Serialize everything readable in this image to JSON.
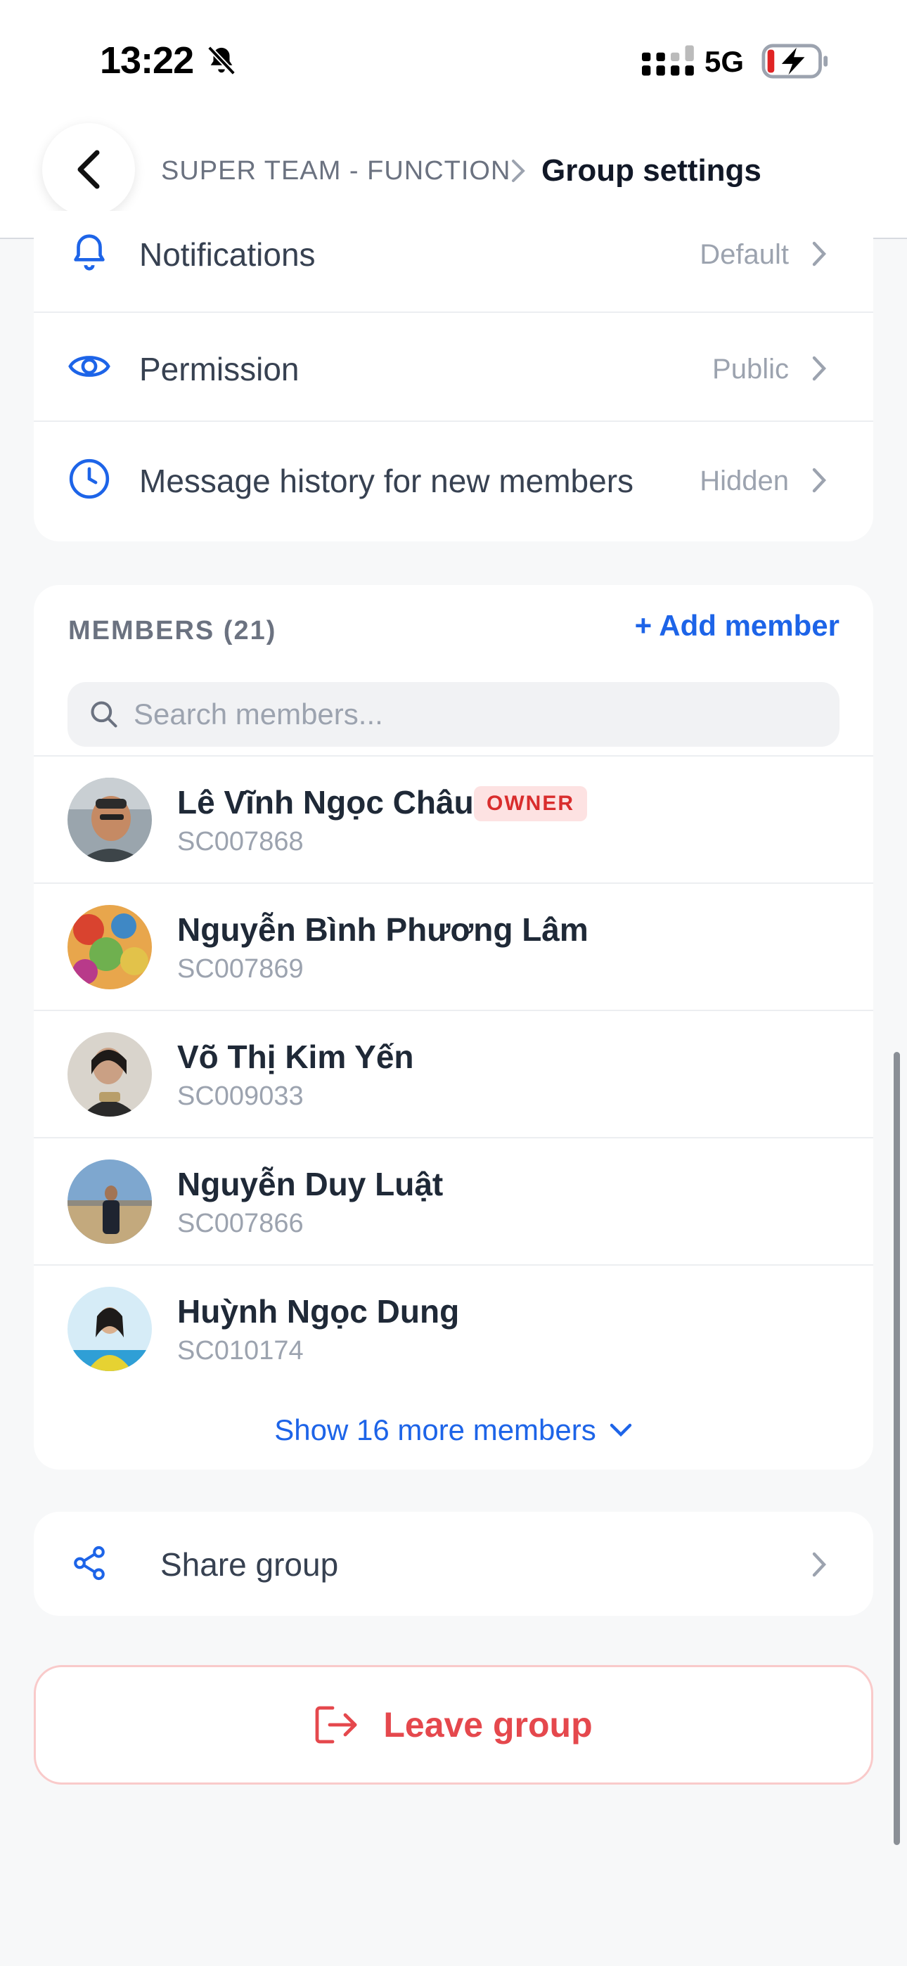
{
  "status_bar": {
    "time": "13:22",
    "network": "5G",
    "icons": [
      "bell-slash-icon",
      "signal-icon",
      "battery-charging-icon"
    ]
  },
  "header": {
    "parent_crumb": "SUPER TEAM - FUNCTION",
    "current_crumb": "Group settings",
    "icons": [
      "chevron-left-icon",
      "chevron-right-icon"
    ]
  },
  "settings": [
    {
      "label": "Notifications",
      "value": "Default",
      "icon": "bell-icon"
    },
    {
      "label": "Permission",
      "value": "Public",
      "icon": "eye-icon"
    },
    {
      "label": "Message history for new members",
      "value": "Hidden",
      "icon": "clock-icon"
    }
  ],
  "members": {
    "title": "MEMBERS (21)",
    "add_label": "+ Add member",
    "search_placeholder": "Search members...",
    "owner_badge": "OWNER",
    "list": [
      {
        "name": "Lê Vĩnh Ngọc Châu",
        "code": "SC007868",
        "owner": true
      },
      {
        "name": "Nguyễn Bình Phương Lâm",
        "code": "SC007869",
        "owner": false
      },
      {
        "name": "Võ Thị Kim Yến",
        "code": "SC009033",
        "owner": false
      },
      {
        "name": "Nguyễn Duy Luật",
        "code": "SC007866",
        "owner": false
      },
      {
        "name": "Huỳnh Ngọc Dung",
        "code": "SC010174",
        "owner": false
      }
    ],
    "show_more_label": "Show 16 more members"
  },
  "share": {
    "label": "Share group",
    "icon": "share-icon"
  },
  "leave": {
    "label": "Leave group",
    "icon": "logout-icon"
  },
  "colors": {
    "accent": "#1d64e8",
    "danger": "#e5484d",
    "muted": "#9ca3af",
    "background": "#f7f8f9"
  }
}
